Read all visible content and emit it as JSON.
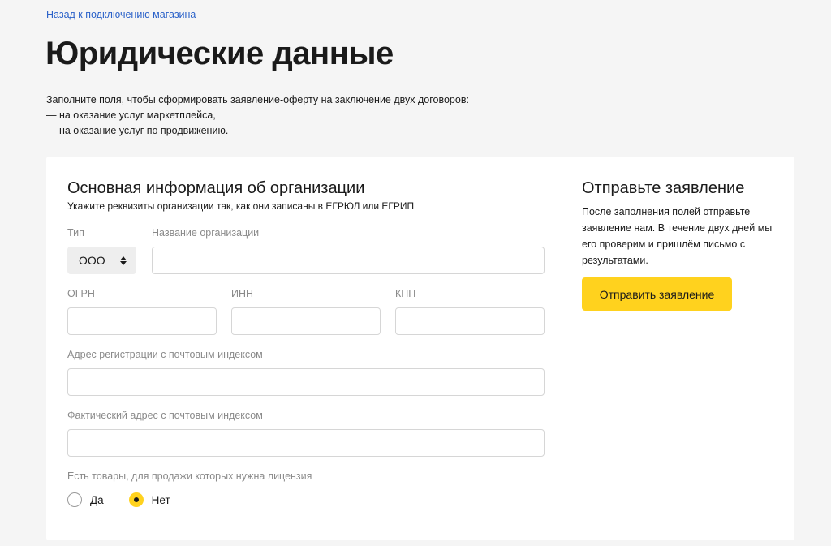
{
  "header": {
    "back_link": "Назад к подключению магазина",
    "title": "Юридические данные"
  },
  "intro": {
    "lines": [
      "Заполните поля, чтобы сформировать заявление-оферту на заключение двух договоров:",
      "— на оказание услуг маркетплейса,",
      "— на оказание услуг по продвижению."
    ]
  },
  "form": {
    "section_title": "Основная информация об организации",
    "section_subtitle": "Укажите реквизиты организации так, как они записаны в ЕГРЮЛ или ЕГРИП",
    "type": {
      "label": "Тип",
      "value": "ООО"
    },
    "org_name": {
      "label": "Название организации",
      "value": ""
    },
    "ogrn": {
      "label": "ОГРН",
      "value": ""
    },
    "inn": {
      "label": "ИНН",
      "value": ""
    },
    "kpp": {
      "label": "КПП",
      "value": ""
    },
    "reg_address": {
      "label": "Адрес регистрации с почтовым индексом",
      "value": ""
    },
    "actual_address": {
      "label": "Фактический адрес с почтовым индексом",
      "value": ""
    },
    "license": {
      "question": "Есть товары, для продажи которых нужна лицензия",
      "options": [
        {
          "label": "Да",
          "selected": false
        },
        {
          "label": "Нет",
          "selected": true
        }
      ]
    }
  },
  "sidebar": {
    "title": "Отправьте заявление",
    "text": "После заполнения полей отправьте заявление нам. В течение двух дней мы его проверим и пришлём письмо с результатами.",
    "button": "Отправить заявление"
  },
  "colors": {
    "accent": "#ffd21e",
    "link": "#2b62c9",
    "background": "#f5f5f5",
    "muted_label": "#8a8a8a"
  }
}
